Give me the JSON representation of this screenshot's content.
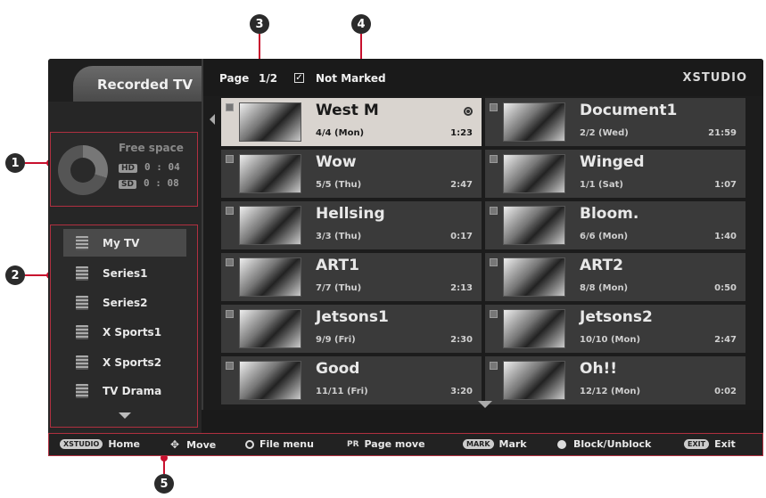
{
  "callouts": [
    "1",
    "2",
    "3",
    "4",
    "5"
  ],
  "app": {
    "title": "Recorded TV",
    "brand": "XSTUDIO"
  },
  "header": {
    "page_label": "Page",
    "page_value": "1/2",
    "filter_label": "Not Marked"
  },
  "space": {
    "label": "Free space",
    "hd_badge": "HD",
    "hd_value": "0 : 04",
    "sd_badge": "SD",
    "sd_value": "0 : 08"
  },
  "folders": [
    {
      "label": "My TV"
    },
    {
      "label": "Series1"
    },
    {
      "label": "Series2"
    },
    {
      "label": "X Sports1"
    },
    {
      "label": "X Sports2"
    },
    {
      "label": "TV Drama"
    }
  ],
  "recordings": [
    {
      "title": "West M",
      "date": "4/4 (Mon)",
      "duration": "1:23"
    },
    {
      "title": "Document1",
      "date": "2/2 (Wed)",
      "duration": "21:59"
    },
    {
      "title": "Wow",
      "date": "5/5 (Thu)",
      "duration": "2:47"
    },
    {
      "title": "Winged",
      "date": "1/1 (Sat)",
      "duration": "1:07"
    },
    {
      "title": "Hellsing",
      "date": "3/3 (Thu)",
      "duration": "0:17"
    },
    {
      "title": "Bloom.",
      "date": "6/6 (Mon)",
      "duration": "1:40"
    },
    {
      "title": "ART1",
      "date": "7/7 (Thu)",
      "duration": "2:13"
    },
    {
      "title": "ART2",
      "date": "8/8 (Mon)",
      "duration": "0:50"
    },
    {
      "title": "Jetsons1",
      "date": "9/9 (Fri)",
      "duration": "2:30"
    },
    {
      "title": "Jetsons2",
      "date": "10/10 (Mon)",
      "duration": "2:47"
    },
    {
      "title": "Good",
      "date": "11/11 (Fri)",
      "duration": "3:20"
    },
    {
      "title": "Oh!!",
      "date": "12/12 (Mon)",
      "duration": "0:02"
    }
  ],
  "footer": {
    "home_key": "XSTUDIO",
    "home": "Home",
    "move": "Move",
    "file_menu": "File menu",
    "page_key": "PR",
    "page_move": "Page move",
    "mark_key": "MARK",
    "mark": "Mark",
    "block": "Block/Unblock",
    "exit_key": "EXIT",
    "exit": "Exit"
  }
}
